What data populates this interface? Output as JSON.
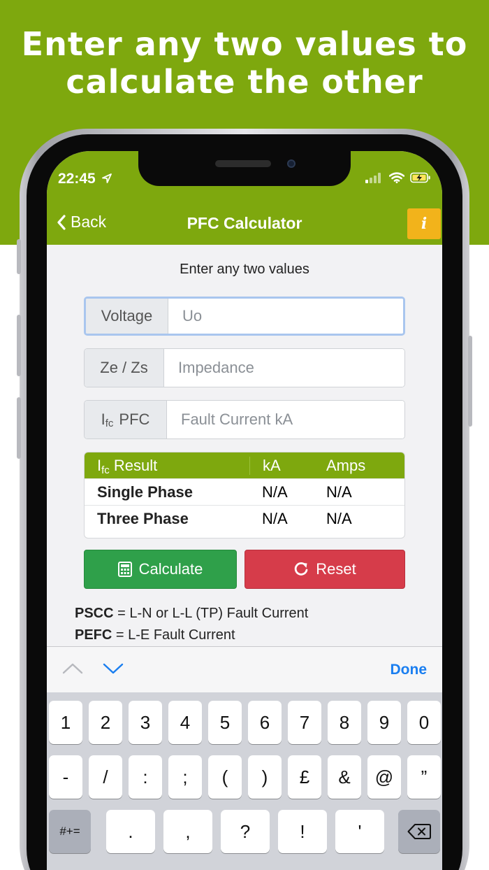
{
  "banner": {
    "line1": "Enter any two values to",
    "line2": "calculate the other"
  },
  "status": {
    "time": "22:45"
  },
  "nav": {
    "back_label": "Back",
    "title": "PFC Calculator",
    "info_label": "i"
  },
  "form": {
    "prompt": "Enter any two values",
    "voltage": {
      "label": "Voltage",
      "placeholder": "Uo"
    },
    "impedance": {
      "label": "Ze / Zs",
      "placeholder": "Impedance"
    },
    "fault": {
      "label_sub": "fc",
      "label_main": "I",
      "label_rest": "PFC",
      "placeholder": "Fault Current kA"
    }
  },
  "results": {
    "header": {
      "label_main": "I",
      "label_sub": "fc",
      "label_rest": "Result",
      "col2": "kA",
      "col3": "Amps"
    },
    "rows": [
      {
        "name": "Single Phase",
        "ka": "N/A",
        "amps": "N/A"
      },
      {
        "name": "Three Phase",
        "ka": "N/A",
        "amps": "N/A"
      }
    ]
  },
  "buttons": {
    "calculate": "Calculate",
    "reset": "Reset"
  },
  "legend": {
    "pscc_term": "PSCC",
    "pscc_def": " = L-N or L-L (TP) Fault Current",
    "pefc_term": "PEFC",
    "pefc_def": " = L-E Fault Current"
  },
  "accessory": {
    "done": "Done"
  },
  "keyboard": {
    "row1": [
      "1",
      "2",
      "3",
      "4",
      "5",
      "6",
      "7",
      "8",
      "9",
      "0"
    ],
    "row2": [
      "-",
      "/",
      ":",
      ";",
      "(",
      ")",
      "£",
      "&",
      "@",
      "”"
    ],
    "row3": [
      "#+=",
      ".",
      ",",
      "?",
      "!",
      "'"
    ]
  },
  "colors": {
    "brand_green": "#7ea80e",
    "calc_green": "#2fa04a",
    "reset_red": "#d63c4a",
    "info_yellow": "#f2b31b",
    "link_blue": "#1a7ef0"
  }
}
